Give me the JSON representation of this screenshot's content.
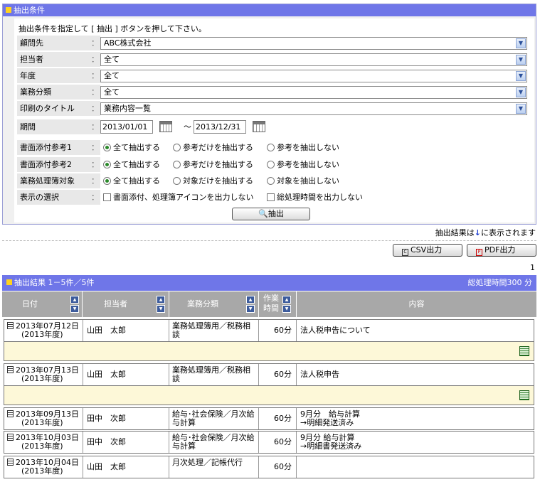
{
  "search_panel": {
    "title": "抽出条件",
    "instruction": "抽出条件を指定して [ 抽出 ] ボタンを押して下さい。",
    "colon": "：",
    "fields": [
      {
        "label": "顧問先",
        "value": "ABC株式会社"
      },
      {
        "label": "担当者",
        "value": "全て"
      },
      {
        "label": "年度",
        "value": "全て"
      },
      {
        "label": "業務分類",
        "value": "全て"
      },
      {
        "label": "印刷のタイトル",
        "value": "業務内容一覧"
      }
    ],
    "period": {
      "label": "期間",
      "from": "2013/01/01",
      "separator": "～",
      "to": "2013/12/31"
    },
    "radio_groups": [
      {
        "label": "書面添付参考1",
        "options": [
          "全て抽出する",
          "参考だけを抽出する",
          "参考を抽出しない"
        ],
        "selected": 0
      },
      {
        "label": "書面添付参考2",
        "options": [
          "全て抽出する",
          "参考だけを抽出する",
          "参考を抽出しない"
        ],
        "selected": 0
      },
      {
        "label": "業務処理簿対象",
        "options": [
          "全て抽出する",
          "対象だけを抽出する",
          "対象を抽出しない"
        ],
        "selected": 0
      }
    ],
    "display": {
      "label": "表示の選択",
      "options": [
        "書面添付、処理簿アイコンを出力しない",
        "総処理時間を出力しない"
      ]
    },
    "search_button": "抽出"
  },
  "result_note": {
    "prefix": "抽出結果は",
    "arrow": "↓",
    "suffix": "に表示されます"
  },
  "export": {
    "csv": "CSV出力",
    "pdf": "PDF出力"
  },
  "page_number": "1",
  "results": {
    "title": "抽出結果 1－5件／5件",
    "total_time": "総処理時間300 分",
    "columns": {
      "date": "日付",
      "user": "担当者",
      "category": "業務分類",
      "time_line1": "作業",
      "time_line2": "時間",
      "content": "内容"
    },
    "rows": [
      {
        "date": "2013年07月12日",
        "fy": "(2013年度)",
        "user": "山田　太郎",
        "category": "業務処理簿用／税務相談",
        "time": "60分",
        "content": "法人税申告について",
        "memo": true
      },
      {
        "date": "2013年07月13日",
        "fy": "(2013年度)",
        "user": "山田　太郎",
        "category": "業務処理簿用／税務相談",
        "time": "60分",
        "content": "法人税申告",
        "memo": true
      },
      {
        "date": "2013年09月13日",
        "fy": "(2013年度)",
        "user": "田中　次郎",
        "category": "給与･社会保険／月次給与計算",
        "time": "60分",
        "content": "9月分　給与計算\n→明細発送済み",
        "memo": false
      },
      {
        "date": "2013年10月03日",
        "fy": "(2013年度)",
        "user": "田中　次郎",
        "category": "給与･社会保険／月次給与計算",
        "time": "60分",
        "content": "9月分 給与計算\n→明細書発送済み",
        "memo": false
      },
      {
        "date": "2013年10月04日",
        "fy": "(2013年度)",
        "user": "山田　太郎",
        "category": "月次処理／記帳代行",
        "time": "60分",
        "content": "",
        "memo": false
      }
    ]
  }
}
